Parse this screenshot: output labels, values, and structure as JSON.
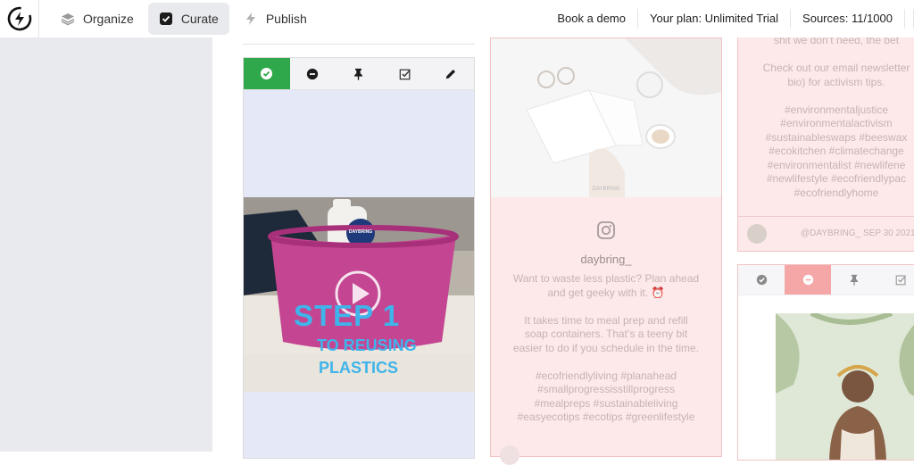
{
  "nav": {
    "items": [
      {
        "label": "Organize",
        "icon": "layers-icon"
      },
      {
        "label": "Curate",
        "icon": "checkbox-icon",
        "active": true
      },
      {
        "label": "Publish",
        "icon": "bolt-icon"
      }
    ]
  },
  "header": {
    "book_demo": "Book a demo",
    "plan": "Your plan: Unlimited Trial",
    "sources": "Sources: 11/1000"
  },
  "card1": {
    "video_text_big": "STEP 1",
    "video_text_line1": "TO REUSING",
    "video_text_line2": "PLASTICS",
    "bottle_label": "DAYBRING"
  },
  "card2": {
    "photo_brand": "DAYBRING",
    "handle": "daybring_",
    "caption": "Want to waste less plastic? Plan ahead\nand get geeky with it. ⏰\n\nIt takes time to meal prep and refill\nsoap containers. That’s a teeny bit\neasier to do if you schedule in the time.\n\n#ecofriendlyliving #planahead\n#smallprogressisstillprogress\n#mealpreps #sustainableliving\n#easyecotips #ecotips #greenlifestyle"
  },
  "card3": {
    "caption": "shit we don’t need, the bet\n\nCheck out our email newsletter\nbio) for activism tips.\n\n#environmentaljustice\n#environmentalactivism\n#sustainableswaps #beeswax\n#ecokitchen #climatechange\n#environmentalist #newlifene\n#newlifestyle #ecofriendlypac\n#ecofriendlyhome",
    "meta": "@DAYBRING_  SEP 30 2021"
  },
  "colors": {
    "approve_green": "#2ea84a",
    "reject_red": "#f5a6a6",
    "rejected_card_bg": "#fde9e9",
    "left_panel": "#e9eaee"
  }
}
